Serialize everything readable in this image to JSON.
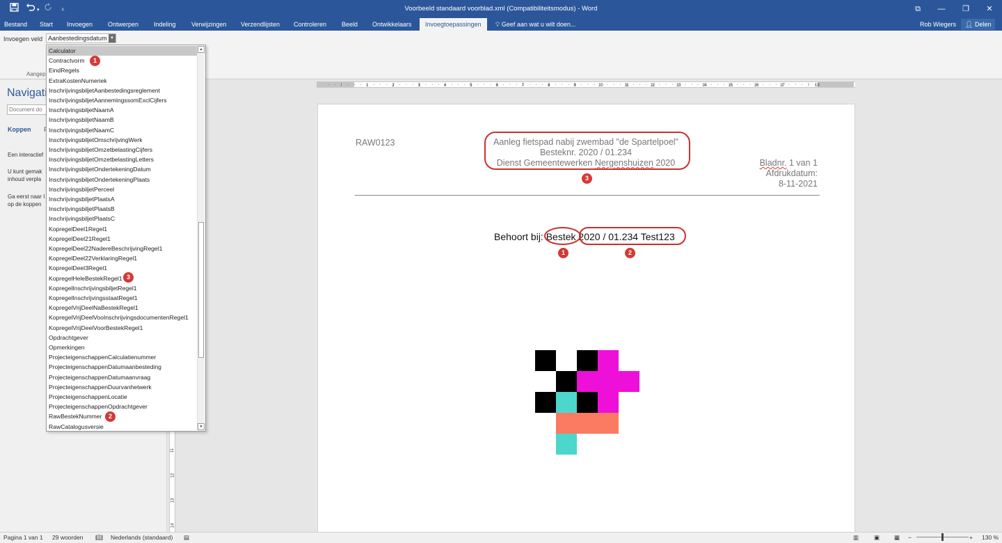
{
  "window": {
    "title": "Voorbeeld standaard voorblad.xml (Compatibiliteitsmodus) - Word",
    "buttons": {
      "restore_ribbon": "⧉",
      "minimize": "—",
      "maximize": "❐",
      "close": "✕"
    }
  },
  "quick_access": {
    "save_icon": "save-icon",
    "undo_icon": "undo-icon",
    "redo_icon": "redo-icon",
    "customize_icon": "customize-icon"
  },
  "ribbon": {
    "tabs": [
      "Bestand",
      "Start",
      "Invoegen",
      "Ontwerpen",
      "Indeling",
      "Verwijzingen",
      "Verzendlijsten",
      "Controleren",
      "Beeld",
      "Ontwikkelaars",
      "Invoegtoepassingen"
    ],
    "active_tab": "Invoegtoepassingen",
    "tell_me": "Geef aan wat u wilt doen...",
    "user": "Rob Wiegers",
    "share": "Delen",
    "insert_field_label": "Invoegen veld",
    "insert_field_value": "Aanbestedingsdatum",
    "group_label": "Aangep"
  },
  "dropdown": {
    "selected": "Calculator",
    "items": [
      "Calculator",
      "Contractvorm",
      "EindRegels",
      "ExtraKostenNumeriek",
      "InschrijvingsbiljetAanbestedingsreglement",
      "InschrijvingsbiljetAannemingssomExclCijfers",
      "InschrijvingsbiljetNaamA",
      "InschrijvingsbiljetNaamB",
      "InschrijvingsbiljetNaamC",
      "InschrijvingsbiljetOmschrijvingWerk",
      "InschrijvingsbiljetOmzetbelastingCijfers",
      "InschrijvingsbiljetOmzetbelastingLetters",
      "InschrijvingsbiljetOndertekeningDatum",
      "InschrijvingsbiljetOndertekeningPlaats",
      "InschrijvingsbiljetPerceel",
      "InschrijvingsbiljetPlaatsA",
      "InschrijvingsbiljetPlaatsB",
      "InschrijvingsbiljetPlaatsC",
      "KopregelDeel1Regel1",
      "KopregelDeel21Regel1",
      "KopregelDeel22NadereBeschrijvingRegel1",
      "KopregelDeel22VerklaringRegel1",
      "KopregelDeel3Regel1",
      "KopregelHeleBestekRegel1",
      "KopregelInschrijvingsbiljetRegel1",
      "KopregelInschrijvingsstaatRegel1",
      "KopregelVrijDeelNaBestekRegel1",
      "KopregelVrijDeelVooInschrijvingsdocumentenRegel1",
      "KopregelVrijDeelVoorBestekRegel1",
      "Opdrachtgever",
      "Opmerkingen",
      "ProjecteigenschappenCalculatienummer",
      "ProjecteigenschappenDatumaanbesteding",
      "ProjecteigenschappenDatumaanvraag",
      "ProjecteigenschappenDuurvanhetwerk",
      "ProjecteigenschappenLocatie",
      "ProjecteigenschappenOpdrachtgever",
      "RawBestekNummer",
      "RawCatalogusversie"
    ]
  },
  "nav_pane": {
    "title": "Navigati",
    "search_placeholder": "Document do",
    "tab_headings": "Koppen",
    "tab_pages": "P",
    "text1_line1": "Een interactief",
    "text2_line1": "U kunt gemak",
    "text2_line2": "inhoud verpla",
    "text3_line1": "Ga eerst naar I",
    "text3_line2": "op de koppen"
  },
  "ruler": {
    "h_numbers": [
      "1",
      "2",
      "3",
      "4",
      "5",
      "6",
      "7",
      "8",
      "9",
      "10",
      "11",
      "12",
      "13",
      "14",
      "15",
      "16",
      "17",
      "19"
    ],
    "v_numbers": [
      "11",
      "12",
      "13",
      "14"
    ]
  },
  "document": {
    "code": "RAW0123",
    "title_line1": "Aanleg fietspad nabij zwembad \"de Spartelpoel\"",
    "title_line2": "Besteknr. 2020 / 01.234",
    "title_line3_a": "Dienst Gemeentewerken ",
    "title_line3_b": "Nergenshuizen",
    "title_line3_c": " 2020",
    "page_label": "Bladnr.",
    "page_value": " 1 van 1",
    "print_date_label": "Afdrukdatum:",
    "print_date": "8-11-2021",
    "belongs_label": "Behoort bij: ",
    "contract_type": "Bestek",
    "contract_number": " 2020 / 01.234 Test123"
  },
  "badges": {
    "one": "1",
    "two": "2",
    "three": "3"
  },
  "logo_colors": {
    "black": "#000000",
    "magenta": "#ee10d9",
    "cyan": "#4dd6cc",
    "salmon": "#fb7a62"
  },
  "accent": "#2b579a",
  "annotation_color": "#c9302c",
  "status": {
    "page": "Pagina 1 van 1",
    "words": "29 woorden",
    "language": "Nederlands (standaard)",
    "zoom": "130 %"
  }
}
